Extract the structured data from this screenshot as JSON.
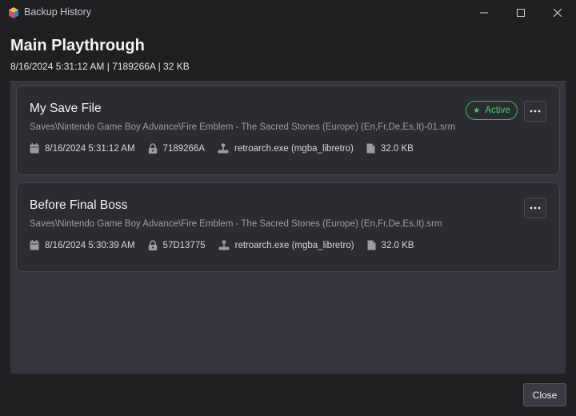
{
  "window": {
    "title": "Backup History"
  },
  "header": {
    "title": "Main Playthrough",
    "subtitle": "8/16/2024 5:31:12 AM | 7189266A | 32 KB"
  },
  "backups": [
    {
      "name": "My Save File",
      "path": "Saves\\Nintendo Game Boy Advance\\Fire Emblem - The Sacred Stones (Europe) (En,Fr,De,Es,It)-01.srm",
      "date": "8/16/2024 5:31:12 AM",
      "hash": "7189266A",
      "emulator": "retroarch.exe (mgba_libretro)",
      "size": "32.0 KB",
      "status": "Active"
    },
    {
      "name": "Before Final Boss",
      "path": "Saves\\Nintendo Game Boy Advance\\Fire Emblem - The Sacred Stones (Europe) (En,Fr,De,Es,It).srm",
      "date": "8/16/2024 5:30:39 AM",
      "hash": "57D13775",
      "emulator": "retroarch.exe (mgba_libretro)",
      "size": "32.0 KB"
    }
  ],
  "footer": {
    "close_label": "Close"
  },
  "colors": {
    "background": "#202023",
    "panel": "#35363d",
    "card": "#2b2c31",
    "active_green": "#4ccb6c"
  }
}
